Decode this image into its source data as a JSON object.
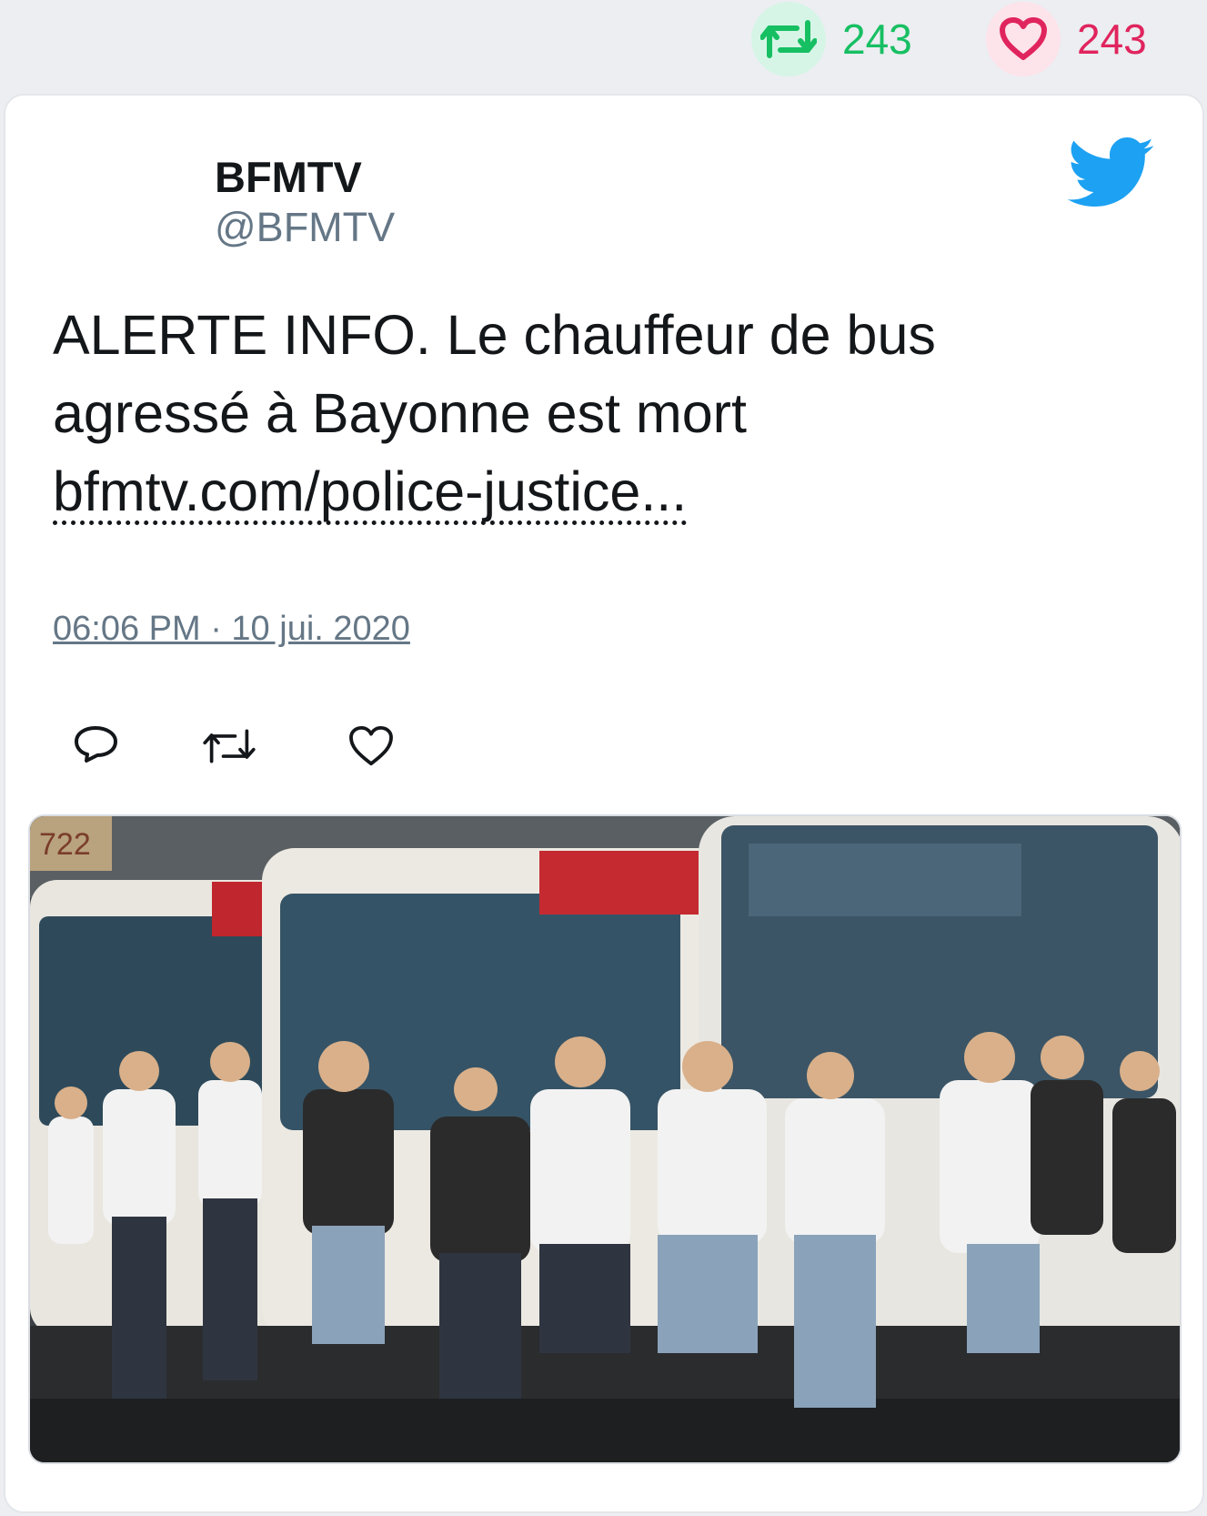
{
  "counters": {
    "retweets": "243",
    "likes": "243"
  },
  "author": {
    "name": "BFMTV",
    "handle": "@BFMTV"
  },
  "tweet": {
    "text": "ALERTE INFO. Le chauffeur de bus agressé à Bayonne est mort",
    "link": "bfmtv.com/police-justice...",
    "timestamp": "06:06 PM · 10 jui. 2020"
  },
  "media": {
    "bus_number": "722"
  },
  "colors": {
    "retweet": "#17bf63",
    "like": "#e0245e",
    "twitter_blue": "#1da1f2",
    "muted": "#657786"
  },
  "icons": {
    "retweet_counter": "retweet-icon",
    "like_counter": "heart-icon",
    "brand": "twitter-bird-icon",
    "reply_action": "reply-icon",
    "retweet_action": "retweet-icon",
    "like_action": "heart-icon"
  }
}
